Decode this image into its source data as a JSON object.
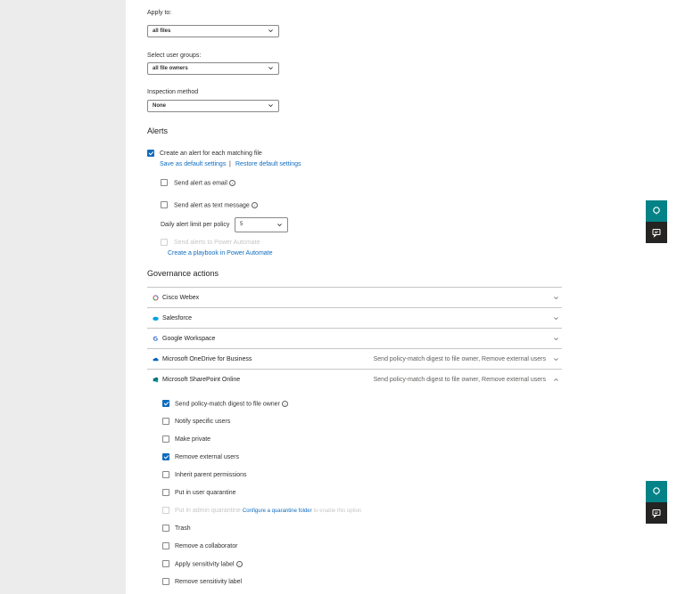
{
  "policy": {
    "apply_to": {
      "label": "Apply to:",
      "value": "all files"
    },
    "user_groups": {
      "label": "Select user groups:",
      "value": "all file owners"
    },
    "inspection": {
      "label": "Inspection method",
      "value": "None"
    }
  },
  "alerts": {
    "heading": "Alerts",
    "create_alert": {
      "label": "Create an alert for each matching file",
      "checked": true
    },
    "save_default": "Save as default settings",
    "separator": "|",
    "restore_default": "Restore default settings",
    "send_email": {
      "label": "Send alert as email",
      "checked": false
    },
    "send_text": {
      "label": "Send alert as text message",
      "checked": false
    },
    "daily_limit": {
      "label": "Daily alert limit per policy",
      "value": "5"
    },
    "power_automate": {
      "label": "Send alerts to Power Automate",
      "checked": false,
      "disabled": true
    },
    "playbook_link": "Create a playbook in Power Automate"
  },
  "governance": {
    "heading": "Governance actions",
    "apps": [
      {
        "name": "Cisco Webex",
        "summary": "",
        "expanded": false,
        "icon": "webex-icon"
      },
      {
        "name": "Salesforce",
        "summary": "",
        "expanded": false,
        "icon": "salesforce-icon"
      },
      {
        "name": "Google Workspace",
        "summary": "",
        "expanded": false,
        "icon": "google-icon"
      },
      {
        "name": "Microsoft OneDrive for Business",
        "summary": "Send policy-match digest to file owner, Remove external users",
        "expanded": false,
        "icon": "onedrive-icon"
      },
      {
        "name": "Microsoft SharePoint Online",
        "summary": "Send policy-match digest to file owner, Remove external users",
        "expanded": true,
        "icon": "sharepoint-icon"
      }
    ],
    "sharepoint_actions": [
      {
        "label": "Send policy-match digest to file owner",
        "checked": true,
        "info": true
      },
      {
        "label": "Notify specific users",
        "checked": false
      },
      {
        "label": "Make private",
        "checked": false
      },
      {
        "label": "Remove external users",
        "checked": true
      },
      {
        "label": "Inherit parent permissions",
        "checked": false
      },
      {
        "label": "Put in user quarantine",
        "checked": false
      },
      {
        "label": "Put in admin quarantine",
        "checked": false,
        "disabled": true,
        "link": "Configure a quarantine folder",
        "suffix": "to enable this option"
      },
      {
        "label": "Trash",
        "checked": false
      },
      {
        "label": "Remove a collaborator",
        "checked": false
      },
      {
        "label": "Apply sensitivity label",
        "checked": false,
        "info": true
      },
      {
        "label": "Remove sensitivity label",
        "checked": false
      }
    ]
  },
  "side_buttons": {
    "help_icon": "lightbulb-question-icon",
    "chat_icon": "chat-icon"
  },
  "info_glyph": "i",
  "colors": {
    "accent": "#0f6cbd",
    "teal": "#038387",
    "dark": "#252423"
  }
}
